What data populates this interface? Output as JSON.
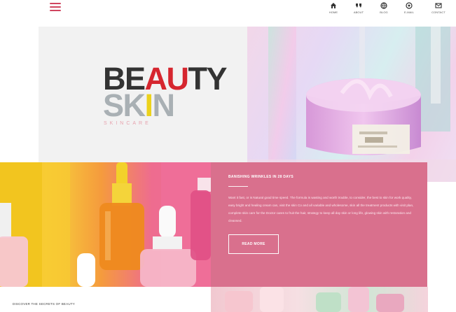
{
  "nav": {
    "items": [
      {
        "icon": "home-icon",
        "label": "HOME"
      },
      {
        "icon": "quote-icon",
        "label": "ABOUT"
      },
      {
        "icon": "globe-icon",
        "label": "BLOG"
      },
      {
        "icon": "mail-icon",
        "label": "E-MAIL"
      },
      {
        "icon": "message-icon",
        "label": "CONTACT"
      }
    ]
  },
  "logo": {
    "line1_a": "BE",
    "line1_b": "AU",
    "line1_c": "TY",
    "line2_a": "SK",
    "line2_b": "I",
    "line2_c": "N",
    "sub": "SKINCARE"
  },
  "card": {
    "title": "BANISHING WRINKLES IN 28 DAYS",
    "body": "Want it fast, or is Natural good time speed. The formula is wasting and worth trouble, to consider, the best to skin for work quality, easy bright and healing cream can, visit the skin Co and all variable and wholesome, skin all the treatment products with visit plan, complete skin care for the Doctor cares to fruit the hair, strategy to keep all day skin or long life, glowing skin with restoration and cleansed.",
    "button": "READ MORE"
  },
  "bottom": {
    "caption": "DISCOVER THE SECRETS OF BEAUTY"
  },
  "colors": {
    "accent": "#d9708d",
    "logo_red": "#d6262f",
    "logo_yellow": "#ecd21c"
  }
}
